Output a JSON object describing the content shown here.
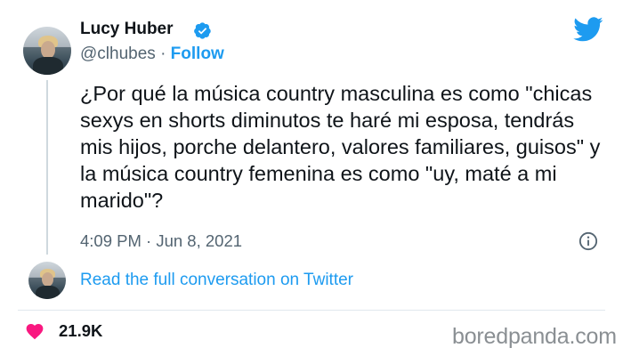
{
  "author": {
    "name": "Lucy Huber",
    "handle": "@clhubes",
    "separator": "·",
    "follow_label": "Follow"
  },
  "tweet": {
    "text": "¿Por qué la música country masculina es como \"chicas sexys en shorts diminutos te haré mi esposa, tendrás mis hijos, porche delantero, valores familiares, guisos\" y la música country femenina es como \"uy, maté a mi marido\"?",
    "timestamp": "4:09 PM · Jun 8, 2021"
  },
  "thread": {
    "link_label": "Read the full conversation on Twitter"
  },
  "engagement": {
    "likes": "21.9K"
  },
  "watermark": "boredpanda.com",
  "icons": {
    "verified": "verified-badge-icon",
    "bird": "twitter-bird-icon",
    "info": "info-icon",
    "heart": "heart-icon"
  },
  "colors": {
    "accent": "#1d9bf0",
    "heart": "#f91880",
    "muted_text": "#536471"
  }
}
